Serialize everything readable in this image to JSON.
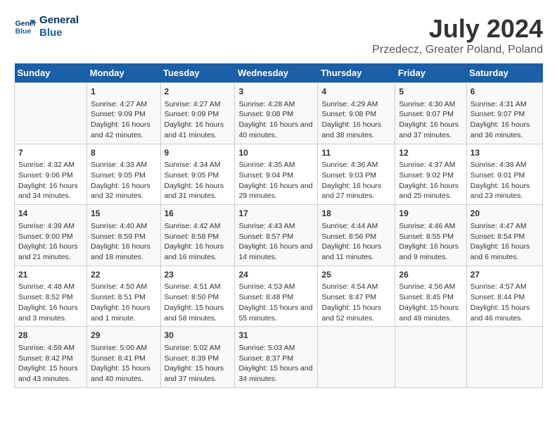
{
  "logo": {
    "line1": "General",
    "line2": "Blue"
  },
  "title": "July 2024",
  "subtitle": "Przedecz, Greater Poland, Poland",
  "days_of_week": [
    "Sunday",
    "Monday",
    "Tuesday",
    "Wednesday",
    "Thursday",
    "Friday",
    "Saturday"
  ],
  "weeks": [
    [
      {
        "day": "",
        "info": ""
      },
      {
        "day": "1",
        "info": "Sunrise: 4:27 AM\nSunset: 9:09 PM\nDaylight: 16 hours and 42 minutes."
      },
      {
        "day": "2",
        "info": "Sunrise: 4:27 AM\nSunset: 9:09 PM\nDaylight: 16 hours and 41 minutes."
      },
      {
        "day": "3",
        "info": "Sunrise: 4:28 AM\nSunset: 9:08 PM\nDaylight: 16 hours and 40 minutes."
      },
      {
        "day": "4",
        "info": "Sunrise: 4:29 AM\nSunset: 9:08 PM\nDaylight: 16 hours and 38 minutes."
      },
      {
        "day": "5",
        "info": "Sunrise: 4:30 AM\nSunset: 9:07 PM\nDaylight: 16 hours and 37 minutes."
      },
      {
        "day": "6",
        "info": "Sunrise: 4:31 AM\nSunset: 9:07 PM\nDaylight: 16 hours and 36 minutes."
      }
    ],
    [
      {
        "day": "7",
        "info": "Sunrise: 4:32 AM\nSunset: 9:06 PM\nDaylight: 16 hours and 34 minutes."
      },
      {
        "day": "8",
        "info": "Sunrise: 4:33 AM\nSunset: 9:05 PM\nDaylight: 16 hours and 32 minutes."
      },
      {
        "day": "9",
        "info": "Sunrise: 4:34 AM\nSunset: 9:05 PM\nDaylight: 16 hours and 31 minutes."
      },
      {
        "day": "10",
        "info": "Sunrise: 4:35 AM\nSunset: 9:04 PM\nDaylight: 16 hours and 29 minutes."
      },
      {
        "day": "11",
        "info": "Sunrise: 4:36 AM\nSunset: 9:03 PM\nDaylight: 16 hours and 27 minutes."
      },
      {
        "day": "12",
        "info": "Sunrise: 4:37 AM\nSunset: 9:02 PM\nDaylight: 16 hours and 25 minutes."
      },
      {
        "day": "13",
        "info": "Sunrise: 4:38 AM\nSunset: 9:01 PM\nDaylight: 16 hours and 23 minutes."
      }
    ],
    [
      {
        "day": "14",
        "info": "Sunrise: 4:39 AM\nSunset: 9:00 PM\nDaylight: 16 hours and 21 minutes."
      },
      {
        "day": "15",
        "info": "Sunrise: 4:40 AM\nSunset: 8:59 PM\nDaylight: 16 hours and 18 minutes."
      },
      {
        "day": "16",
        "info": "Sunrise: 4:42 AM\nSunset: 8:58 PM\nDaylight: 16 hours and 16 minutes."
      },
      {
        "day": "17",
        "info": "Sunrise: 4:43 AM\nSunset: 8:57 PM\nDaylight: 16 hours and 14 minutes."
      },
      {
        "day": "18",
        "info": "Sunrise: 4:44 AM\nSunset: 8:56 PM\nDaylight: 16 hours and 11 minutes."
      },
      {
        "day": "19",
        "info": "Sunrise: 4:46 AM\nSunset: 8:55 PM\nDaylight: 16 hours and 9 minutes."
      },
      {
        "day": "20",
        "info": "Sunrise: 4:47 AM\nSunset: 8:54 PM\nDaylight: 16 hours and 6 minutes."
      }
    ],
    [
      {
        "day": "21",
        "info": "Sunrise: 4:48 AM\nSunset: 8:52 PM\nDaylight: 16 hours and 3 minutes."
      },
      {
        "day": "22",
        "info": "Sunrise: 4:50 AM\nSunset: 8:51 PM\nDaylight: 16 hours and 1 minute."
      },
      {
        "day": "23",
        "info": "Sunrise: 4:51 AM\nSunset: 8:50 PM\nDaylight: 15 hours and 58 minutes."
      },
      {
        "day": "24",
        "info": "Sunrise: 4:53 AM\nSunset: 8:48 PM\nDaylight: 15 hours and 55 minutes."
      },
      {
        "day": "25",
        "info": "Sunrise: 4:54 AM\nSunset: 8:47 PM\nDaylight: 15 hours and 52 minutes."
      },
      {
        "day": "26",
        "info": "Sunrise: 4:56 AM\nSunset: 8:45 PM\nDaylight: 15 hours and 49 minutes."
      },
      {
        "day": "27",
        "info": "Sunrise: 4:57 AM\nSunset: 8:44 PM\nDaylight: 15 hours and 46 minutes."
      }
    ],
    [
      {
        "day": "28",
        "info": "Sunrise: 4:59 AM\nSunset: 8:42 PM\nDaylight: 15 hours and 43 minutes."
      },
      {
        "day": "29",
        "info": "Sunrise: 5:00 AM\nSunset: 8:41 PM\nDaylight: 15 hours and 40 minutes."
      },
      {
        "day": "30",
        "info": "Sunrise: 5:02 AM\nSunset: 8:39 PM\nDaylight: 15 hours and 37 minutes."
      },
      {
        "day": "31",
        "info": "Sunrise: 5:03 AM\nSunset: 8:37 PM\nDaylight: 15 hours and 34 minutes."
      },
      {
        "day": "",
        "info": ""
      },
      {
        "day": "",
        "info": ""
      },
      {
        "day": "",
        "info": ""
      }
    ]
  ]
}
